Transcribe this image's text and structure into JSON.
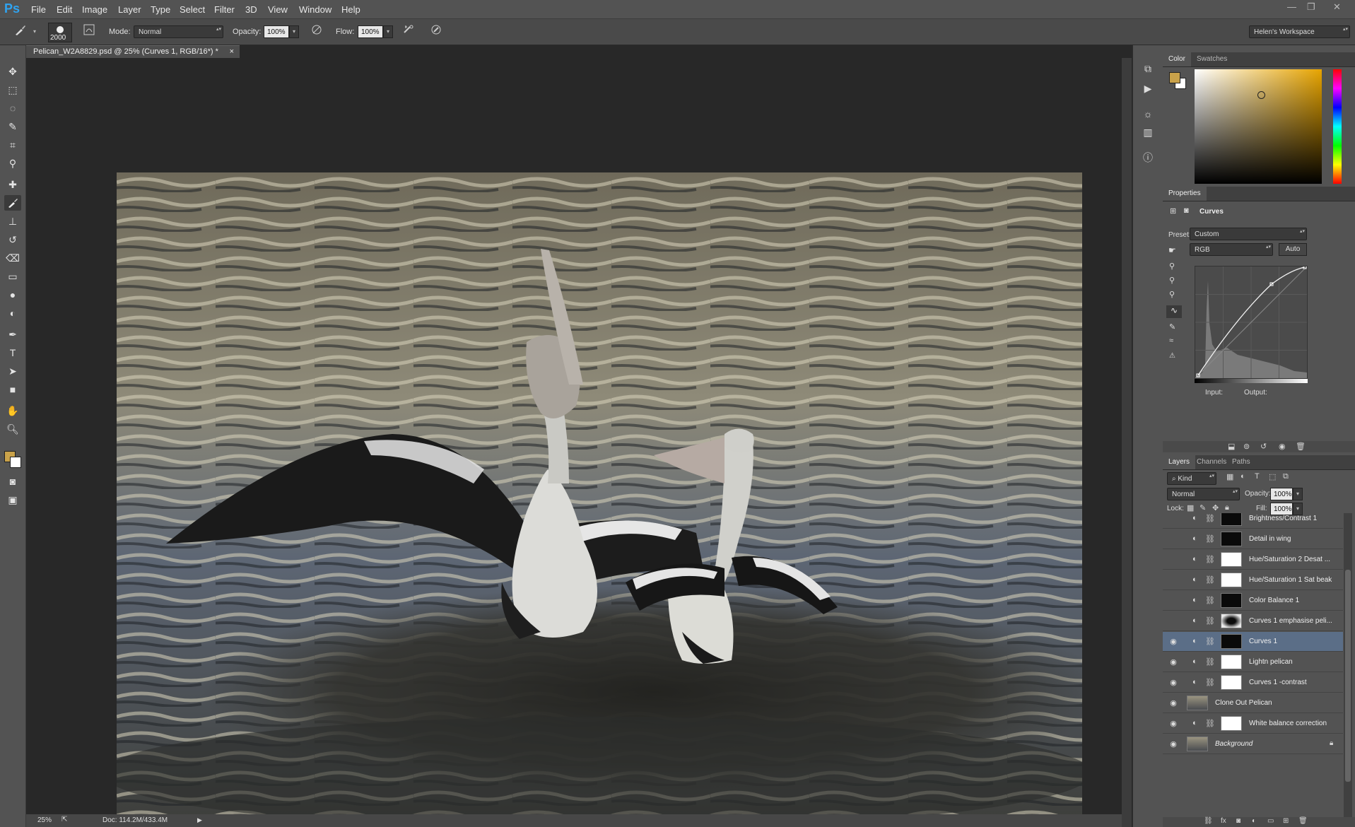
{
  "app": {
    "logo": "Ps"
  },
  "menu": [
    "File",
    "Edit",
    "Image",
    "Layer",
    "Type",
    "Select",
    "Filter",
    "3D",
    "View",
    "Window",
    "Help"
  ],
  "window_controls": [
    "—",
    "❐",
    "✕"
  ],
  "options_bar": {
    "brush_size": "2000",
    "mode_label": "Mode:",
    "mode_value": "Normal",
    "opacity_label": "Opacity:",
    "opacity_value": "100%",
    "flow_label": "Flow:",
    "flow_value": "100%",
    "workspace": "Helen's Workspace"
  },
  "document": {
    "tab_title": "Pelican_W2A8829.psd @ 25% (Curves 1, RGB/16*) *",
    "tab_close": "×",
    "zoom": "25%",
    "doc_size": "Doc: 114.2M/433.4M"
  },
  "color_panel": {
    "tabs": [
      "Color",
      "Swatches"
    ],
    "foreground_color": "#c9a24a",
    "background_color": "#ffffff"
  },
  "properties_panel": {
    "title": "Properties",
    "type": "Curves",
    "preset_label": "Preset:",
    "preset_value": "Custom",
    "channel_value": "RGB",
    "auto_label": "Auto",
    "input_label": "Input:",
    "output_label": "Output:"
  },
  "layers_panel": {
    "tabs": [
      "Layers",
      "Channels",
      "Paths"
    ],
    "filter_label": "Kind",
    "blend_mode": "Normal",
    "opacity_label": "Opacity:",
    "opacity_value": "100%",
    "lock_label": "Lock:",
    "fill_label": "Fill:",
    "fill_value": "100%",
    "layers": [
      {
        "name": "Brightness/Contrast 1",
        "visible": false,
        "mask": "dark"
      },
      {
        "name": "Detail in wing",
        "visible": false,
        "mask": "dark"
      },
      {
        "name": "Hue/Saturation 2 Desat ...",
        "visible": false,
        "mask": "white"
      },
      {
        "name": "Hue/Saturation 1 Sat beak",
        "visible": false,
        "mask": "white"
      },
      {
        "name": "Color Balance 1",
        "visible": false,
        "mask": "dark"
      },
      {
        "name": "Curves 1 emphasise peli...",
        "visible": false,
        "mask": "gradient"
      },
      {
        "name": "Curves 1",
        "visible": true,
        "mask": "dark",
        "selected": true
      },
      {
        "name": "Lightn pelican",
        "visible": true,
        "mask": "white"
      },
      {
        "name": "Curves 1 -contrast",
        "visible": true,
        "mask": "white"
      },
      {
        "name": "Clone Out Pelican",
        "visible": true,
        "mask": "photo"
      },
      {
        "name": "White balance correction",
        "visible": true,
        "mask": "white"
      },
      {
        "name": "Background",
        "visible": true,
        "mask": "photo"
      }
    ]
  }
}
